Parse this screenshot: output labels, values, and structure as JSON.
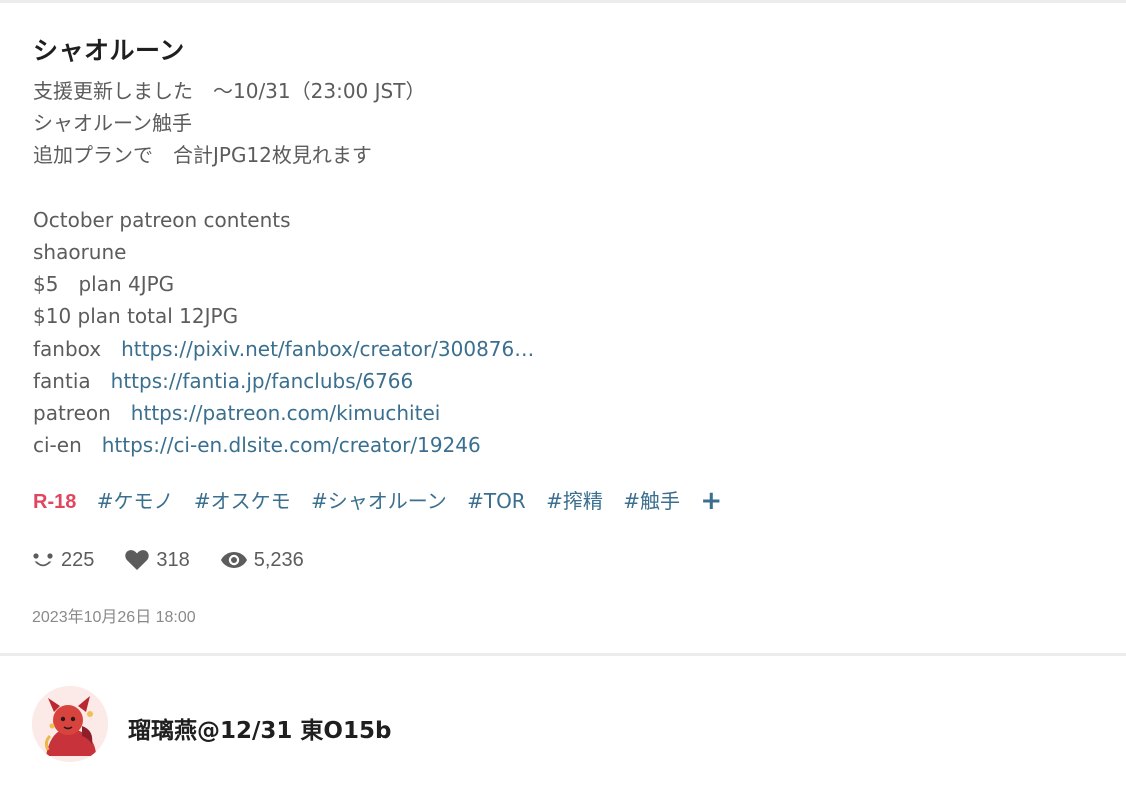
{
  "post": {
    "title": "シャオルーン",
    "caption_lines": [
      {
        "text": "支援更新しました　～10/31（23:00 JST）"
      },
      {
        "text": "シャオルーン触手"
      },
      {
        "text": "追加プランで　合計JPG12枚見れます"
      },
      {
        "text": ""
      },
      {
        "text": "October patreon contents"
      },
      {
        "text": "shaorune"
      },
      {
        "text": "$5　plan 4JPG"
      },
      {
        "text": "$10 plan total 12JPG"
      },
      {
        "prefix": "fanbox　",
        "link": "https://pixiv.net/fanbox/creator/300876…"
      },
      {
        "prefix": "fantia　",
        "link": "https://fantia.jp/fanclubs/6766"
      },
      {
        "prefix": "patreon　",
        "link": "https://patreon.com/kimuchitei"
      },
      {
        "prefix": "ci-en　",
        "link": "https://ci-en.dlsite.com/creator/19246"
      }
    ],
    "tags": {
      "rating": "R-18",
      "items": [
        "#ケモノ",
        "#オスケモ",
        "#シャオルーン",
        "#TOR",
        "#搾精",
        "#触手"
      ],
      "more": "+"
    },
    "stats": {
      "likes": "225",
      "bookmarks": "318",
      "views": "5,236"
    },
    "date": "2023年10月26日 18:00"
  },
  "author": {
    "name": "瑠璃燕@12/31 東O15b"
  },
  "colors": {
    "link": "#3a6f8f",
    "rating": "#e0475f",
    "text_muted": "#5c5c5c"
  },
  "icons": {
    "likes": "smile-icon",
    "bookmarks": "heart-icon",
    "views": "eye-icon",
    "more": "plus-icon"
  }
}
